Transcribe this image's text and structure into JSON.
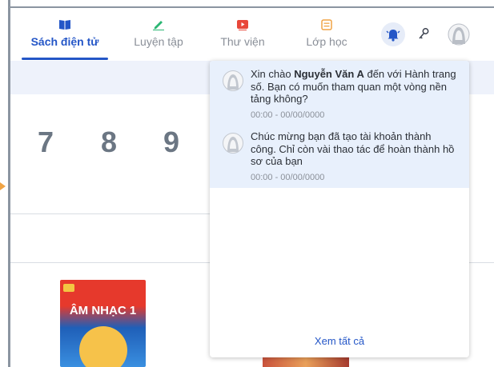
{
  "nav": {
    "tabs": [
      {
        "label": "Sách điện tử",
        "icon": "book-icon",
        "color": "#2456c7"
      },
      {
        "label": "Luyện tập",
        "icon": "pencil-icon",
        "color": "#2bb673"
      },
      {
        "label": "Thư viện",
        "icon": "play-icon",
        "color": "#e8473a"
      },
      {
        "label": "Lớp học",
        "icon": "class-icon",
        "color": "#f0a445"
      }
    ]
  },
  "grades": [
    "7",
    "8",
    "9"
  ],
  "books": [
    {
      "title": "ÂM NHẠC 1"
    }
  ],
  "notifications": {
    "items": [
      {
        "pre": "Xin chào ",
        "name": "Nguyễn Văn A",
        "post": " đến với Hành trang số. Bạn có muốn tham quan một vòng nền tảng không?",
        "time": "00:00 - 00/00/0000"
      },
      {
        "pre": "Chúc mừng bạn đã tạo tài khoản thành công. Chỉ còn vài thao tác  để hoàn thành hồ sơ của bạn",
        "name": "",
        "post": "",
        "time": "00:00 - 00/00/0000"
      }
    ],
    "see_all": "Xem tất cả"
  }
}
